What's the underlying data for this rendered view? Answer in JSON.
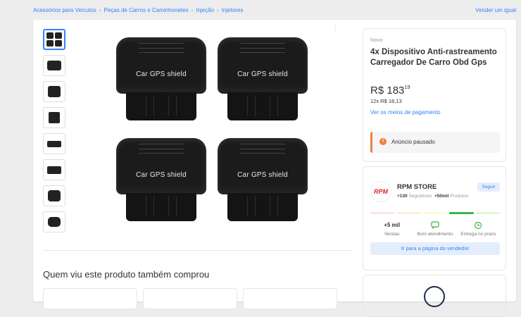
{
  "breadcrumb": {
    "items": [
      "Acessórios para Veículos",
      "Peças de Carros e Caminhonetes",
      "Injeção",
      "Injetores"
    ],
    "separator": "›"
  },
  "header": {
    "sell_link": "Vender um igual"
  },
  "gallery": {
    "thumbnail_count": 8,
    "product_label": "Car GPS shield",
    "menu_icon": "vertical-dots-icon"
  },
  "product": {
    "condition": "Novo",
    "title": "4x Dispositivo Anti-rastreamento Carregador De Carro Obd Gps",
    "price_currency": "R$",
    "price_int": "183",
    "price_cents": "19",
    "installments": "12x R$ 18,13",
    "payment_link": "Ver os meios de pagamento",
    "status": "Anúncio pausado",
    "status_icon": "!",
    "status_color": "#f0803c"
  },
  "seller": {
    "logo_text": "RPM",
    "name": "RPM STORE",
    "followers_value": "+130",
    "followers_label": "Seguidores",
    "products_value": "+50mil",
    "products_label": "Produtos",
    "follow_label": "Seguir",
    "sales_value": "+5 mil",
    "sales_label": "Vendas",
    "service_label": "Bom atendimento",
    "delivery_label": "Entrega no prazo",
    "page_button": "Ir para a página do vendedor",
    "reputation_colors": [
      "#fde6e6",
      "#fff0dc",
      "#fff8d6",
      "#e6f4d6",
      "#39b54a"
    ]
  },
  "recommendations": {
    "title": "Quem viu este produto também comprou"
  },
  "colors": {
    "accent": "#3483fa",
    "background": "#ededed"
  }
}
